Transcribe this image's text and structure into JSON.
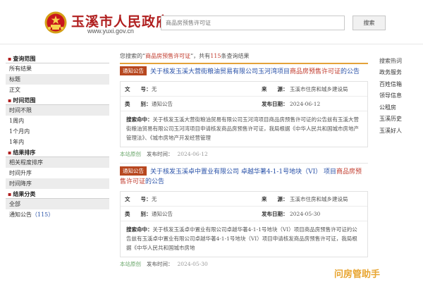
{
  "header": {
    "site_title": "玉溪市人民政府",
    "site_url": "www.yuxi.gov.cn",
    "search_value": "商品房预售许可证",
    "search_button": "搜索"
  },
  "sidebar": {
    "groups": [
      {
        "heading": "查询范围",
        "items": [
          "所有结果",
          "标题",
          "正文"
        ]
      },
      {
        "heading": "时间范围",
        "items": [
          "时间不限",
          "1周内",
          "1个月内",
          "1年内"
        ]
      },
      {
        "heading": "结果排序",
        "items": [
          "相关程度排序",
          "时间升序",
          "时间降序"
        ]
      },
      {
        "heading": "结果分类",
        "items": [
          "全部",
          "通知公告"
        ]
      }
    ],
    "notice_count": "（115）"
  },
  "summary": {
    "prefix": "您搜索的“",
    "keyword": "商品房预售许可证",
    "middle": "”，共有",
    "count": "115",
    "suffix": "条查询结果"
  },
  "results": [
    {
      "tag": "通知公告",
      "title_pre": "关于核发玉溪大营街粮油贸易有限公司玉河湾项目",
      "title_hl": "商品房预售许可证",
      "title_post": "的公告",
      "doc_no_label": "文　　号：",
      "doc_no": "无",
      "source_label": "来　　源：",
      "source": "玉溪市住房和城乡建设局",
      "category_label": "类　　别：",
      "category": "通知公告",
      "pubdate_label": "发布日期：",
      "pubdate": "2024-06-12",
      "abstract_label": "搜索命中：",
      "abstract": "关于核发玉溪大营街粮油贸易有限公司玉河湾项目商品房预售许可证的公告兹有玉溪大营街粮油贸易有限公司玉河湾项目申请核发商品房预售许可证，我局根据《中华人民共和国城市房地产管理法》、《城市房地产开发经营管理",
      "site": "本站原创",
      "foot_label": "发布时间：",
      "foot_date": "2024-06-12"
    },
    {
      "tag": "通知公告",
      "title_pre": "关于核发玉溪卓中置业有限公司 卓越华著4-1-1号地块（VI） 项目",
      "title_hl": "商品房预售许可证",
      "title_post": "的公告",
      "doc_no_label": "文　　号：",
      "doc_no": "无",
      "source_label": "来　　源：",
      "source": "玉溪市住房和城乡建设局",
      "category_label": "类　　别：",
      "category": "通知公告",
      "pubdate_label": "发布日期：",
      "pubdate": "2024-05-30",
      "abstract_label": "搜索命中：",
      "abstract": "关于核发玉溪卓中置业有限公司卓越华著4-1-1号地块（VI）项目商品房预售许可证的公告兹有玉溪卓中置业有限公司卓越华著4-1-1号地块（VI）项目申请核发商品房预售许可证，我局根据《中华人民共和国城市房地",
      "site": "本站原创",
      "foot_label": "发布时间：",
      "foot_date": "2024-05-30"
    }
  ],
  "right": {
    "heading": "搜索热词",
    "items": [
      "政务服务",
      "百姓信箱",
      "领导信息",
      "公租房",
      "玉溪历史",
      "玉溪好人"
    ]
  },
  "watermark": "问房管助手",
  "colors": {
    "brand_red": "#b01e1e",
    "tag_bg": "#b7471f",
    "link_blue": "#2a52a8",
    "highlight": "#c0392b",
    "accent_orange": "#e4a23a"
  }
}
